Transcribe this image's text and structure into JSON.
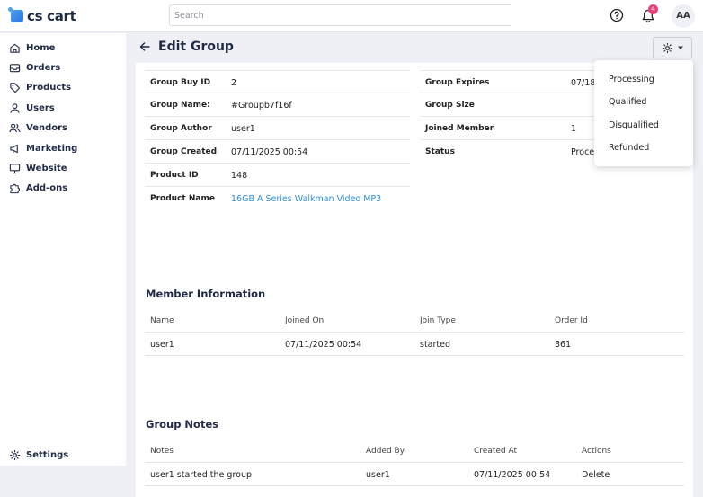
{
  "brand": {
    "name": "cs cart"
  },
  "search": {
    "placeholder": "Search"
  },
  "header": {
    "notifications_count": "4",
    "avatar_initials": "AA"
  },
  "sidebar": {
    "items": [
      {
        "label": "Home",
        "icon": "home-icon"
      },
      {
        "label": "Orders",
        "icon": "inbox-icon"
      },
      {
        "label": "Products",
        "icon": "tag-icon"
      },
      {
        "label": "Users",
        "icon": "user-icon"
      },
      {
        "label": "Vendors",
        "icon": "users-icon"
      },
      {
        "label": "Marketing",
        "icon": "megaphone-icon"
      },
      {
        "label": "Website",
        "icon": "monitor-icon"
      },
      {
        "label": "Add-ons",
        "icon": "puzzle-icon"
      }
    ],
    "settings_label": "Settings"
  },
  "page": {
    "title": "Edit Group"
  },
  "details": {
    "left": [
      {
        "label": "Group Buy ID",
        "value": "2"
      },
      {
        "label": "Group Name:",
        "value": "#Groupb7f16f"
      },
      {
        "label": "Group Author",
        "value": "user1"
      },
      {
        "label": "Group Created",
        "value": "07/11/2025 00:54"
      },
      {
        "label": "Product ID",
        "value": "148"
      },
      {
        "label": "Product Name",
        "value": "16GB A Series Walkman Video MP3"
      }
    ],
    "right": [
      {
        "label": "Group Expires",
        "value": "07/18"
      },
      {
        "label": "Group Size",
        "value": ""
      },
      {
        "label": "Joined Member",
        "value": "1"
      },
      {
        "label": "Status",
        "value": "Proce"
      }
    ]
  },
  "members": {
    "title": "Member Information",
    "columns": [
      "Name",
      "Joined On",
      "Join Type",
      "Order Id"
    ],
    "rows": [
      {
        "name": "user1",
        "joined_on": "07/11/2025 00:54",
        "join_type": "started",
        "order_id": "361"
      }
    ]
  },
  "notes": {
    "title": "Group Notes",
    "columns": [
      "Notes",
      "Added By",
      "Created At",
      "Actions"
    ],
    "rows": [
      {
        "note": "user1 started the group",
        "added_by": "user1",
        "created_at": "07/11/2025 00:54",
        "action": "Delete"
      }
    ]
  },
  "status_menu": {
    "options": [
      "Processing",
      "Qualified",
      "Disqualified",
      "Refunded"
    ]
  },
  "colors": {
    "accent": "#2f8fd8",
    "badge": "#ef3f7a",
    "brand": "#2f6fe0"
  }
}
